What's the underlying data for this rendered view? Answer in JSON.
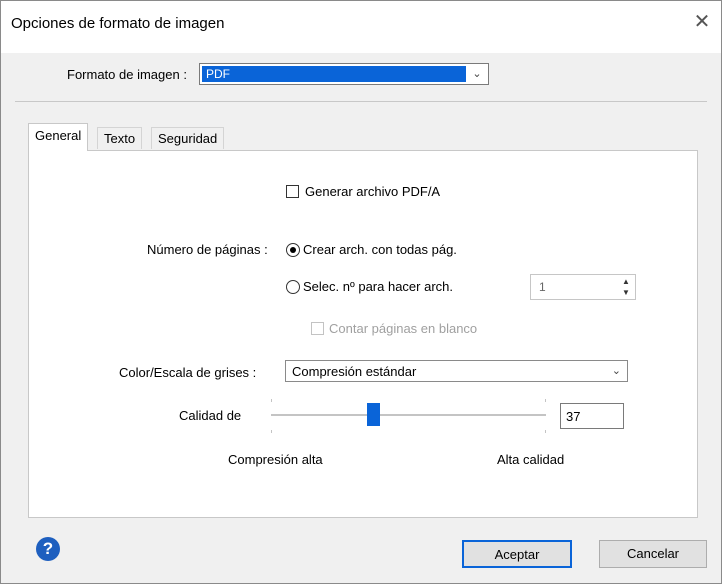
{
  "dialog": {
    "title": "Opciones de formato de imagen",
    "close_glyph": "✕"
  },
  "format": {
    "label": "Formato de imagen :",
    "value": "PDF",
    "arrow": "⌄"
  },
  "tabs": [
    {
      "label": "General",
      "active": true
    },
    {
      "label": "Texto",
      "active": false
    },
    {
      "label": "Seguridad",
      "active": false
    }
  ],
  "general": {
    "pdfa": {
      "label": "Generar archivo PDF/A",
      "checked": false
    },
    "pages": {
      "label": "Número de páginas :",
      "options": [
        {
          "label": "Crear arch. con todas pág.",
          "selected": true
        },
        {
          "label": "Selec. nº para hacer arch.",
          "selected": false
        }
      ],
      "count_value": "1",
      "spin_up": "▲",
      "spin_down": "▼"
    },
    "blank_pages": {
      "label": "Contar páginas en blanco",
      "checked": false,
      "enabled": false
    },
    "color": {
      "label": "Color/Escala de grises :",
      "value": "Compresión estándar",
      "arrow": "⌄"
    },
    "quality": {
      "label": "Calidad de",
      "value": "37",
      "min_label": "Compresión alta",
      "max_label": "Alta calidad",
      "level": 0.37
    }
  },
  "footer": {
    "help_glyph": "?",
    "ok_label": "Aceptar",
    "cancel_label": "Cancelar"
  },
  "colors": {
    "accent": "#0a64d8",
    "help": "#1e5fbf"
  }
}
